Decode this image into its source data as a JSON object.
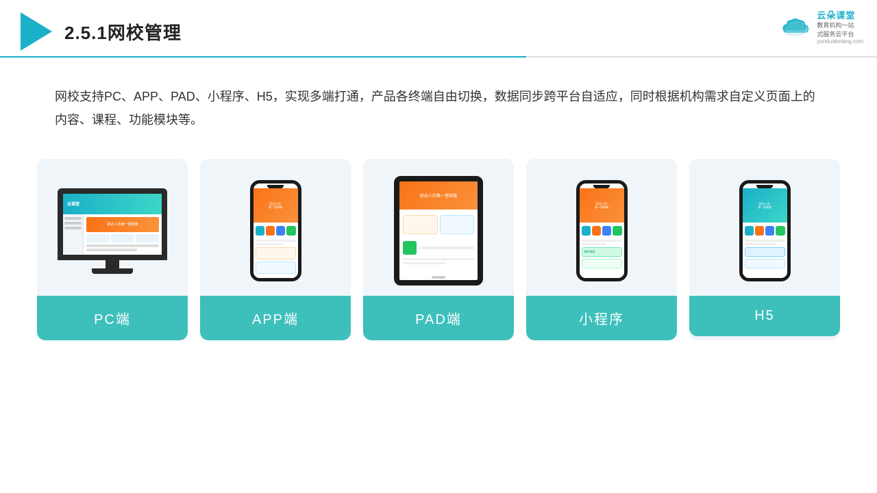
{
  "header": {
    "title": "2.5.1网校管理",
    "divider_color": "#1ab0c8"
  },
  "brand": {
    "name": "云朵课堂",
    "tagline": "教育机构一站\n式服务云平台",
    "url": "yunduoketang.com"
  },
  "description": {
    "text": "网校支持PC、APP、PAD、小程序、H5，实现多端打通，产品各终端自由切换，数据同步跨平台自适应，同时根据机构需求自定义页面上的内容、课程、功能模块等。"
  },
  "cards": [
    {
      "id": "pc",
      "label": "PC端"
    },
    {
      "id": "app",
      "label": "APP端"
    },
    {
      "id": "pad",
      "label": "PAD端"
    },
    {
      "id": "miniprogram",
      "label": "小程序"
    },
    {
      "id": "h5",
      "label": "H5"
    }
  ]
}
